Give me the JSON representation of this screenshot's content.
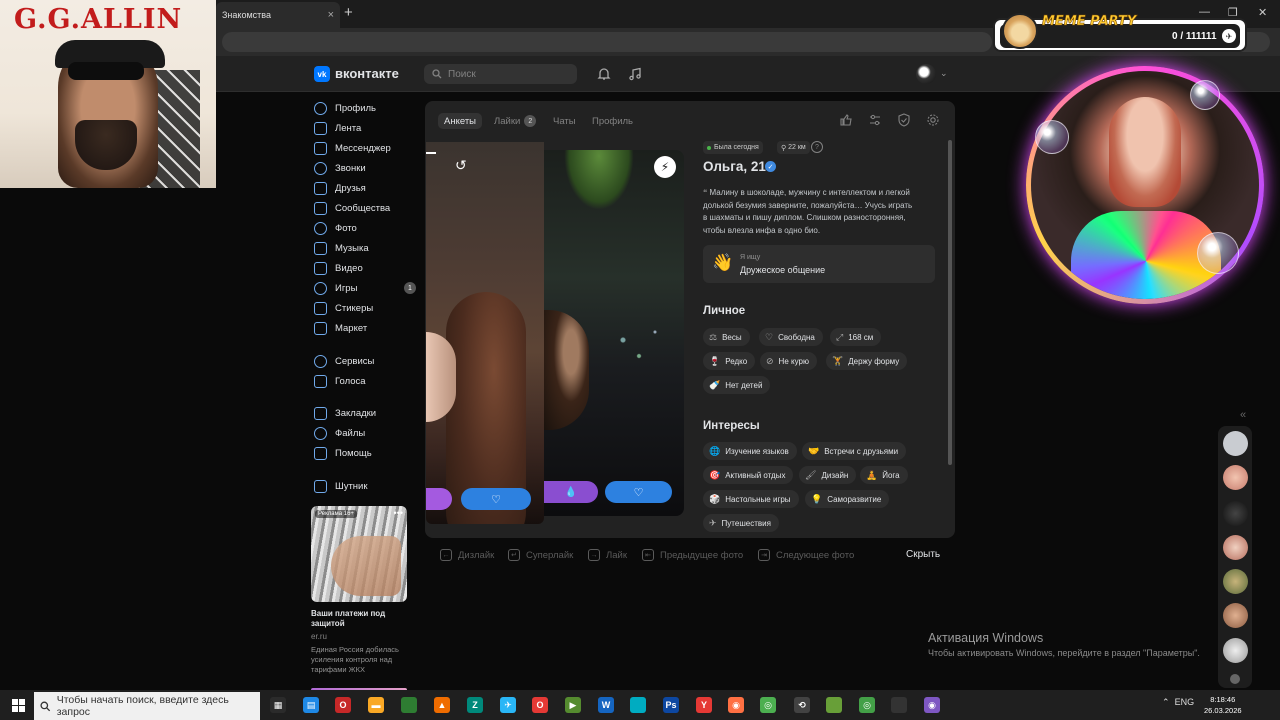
{
  "browser": {
    "tab_title": "Знакомства",
    "tab_close": "×",
    "new_tab": "+",
    "min": "—",
    "restore": "❐",
    "close": "✕"
  },
  "vk": {
    "logo_letter": "vk",
    "name": "вконтакте",
    "search_placeholder": "Поиск",
    "accent": "#0077ff"
  },
  "nav": {
    "items": [
      {
        "label": "Профиль",
        "icon": "user-circle-icon"
      },
      {
        "label": "Лента",
        "icon": "feed-icon"
      },
      {
        "label": "Мессенджер",
        "icon": "chat-icon"
      },
      {
        "label": "Звонки",
        "icon": "phone-icon"
      },
      {
        "label": "Друзья",
        "icon": "friends-icon"
      },
      {
        "label": "Сообщества",
        "icon": "groups-icon"
      },
      {
        "label": "Фото",
        "icon": "photo-icon"
      },
      {
        "label": "Музыка",
        "icon": "music-icon"
      },
      {
        "label": "Видео",
        "icon": "video-icon"
      },
      {
        "label": "Игры",
        "icon": "games-icon",
        "badge": "1"
      },
      {
        "label": "Стикеры",
        "icon": "stickers-icon"
      },
      {
        "label": "Маркет",
        "icon": "market-icon"
      },
      {
        "label": "Сервисы",
        "icon": "services-icon"
      },
      {
        "label": "Голоса",
        "icon": "votes-icon"
      },
      {
        "label": "Закладки",
        "icon": "bookmark-icon"
      },
      {
        "label": "Файлы",
        "icon": "files-icon"
      },
      {
        "label": "Помощь",
        "icon": "help-icon"
      },
      {
        "label": "Шутник",
        "icon": "community-icon"
      }
    ]
  },
  "ad": {
    "label": "Реклама 16+",
    "dots": "•••",
    "title": "Ваши платежи под защитой",
    "url": "er.ru",
    "description": "Единая Россия добилась усиления контроля над тарифами ЖКХ"
  },
  "dating": {
    "tabs": [
      {
        "label": "Анкеты",
        "active": true
      },
      {
        "label": "Лайки",
        "count": "2"
      },
      {
        "label": "Чаты"
      },
      {
        "label": "Профиль"
      }
    ],
    "status": "Была сегодня",
    "distance": "22 км",
    "help": "?",
    "name": "Ольга, 21",
    "bio": "Малину в шоколаде, мужчину с интеллектом и легкой долькой безумия заверните, пожалуйста… Учусь играть в шахматы и пишу диплом. Слишком разносторонняя, чтобы влезла инфа в одно био.",
    "seeking_label": "Я ищу",
    "seeking_value": "Дружеское общение",
    "personal_title": "Личное",
    "personal": [
      {
        "icon": "⚖",
        "label": "Весы"
      },
      {
        "icon": "♡",
        "label": "Свободна"
      },
      {
        "icon": "⤢",
        "label": "168 см"
      },
      {
        "icon": "🍷",
        "label": "Редко"
      },
      {
        "icon": "⊘",
        "label": "Не курю"
      },
      {
        "icon": "🏋",
        "label": "Держу форму"
      },
      {
        "icon": "🍼",
        "label": "Нет детей"
      }
    ],
    "interests_title": "Интересы",
    "interests": [
      {
        "icon": "🌐",
        "label": "Изучение языков"
      },
      {
        "icon": "🤝",
        "label": "Встречи с друзьями"
      },
      {
        "icon": "🎯",
        "label": "Активный отдых"
      },
      {
        "icon": "🖌",
        "label": "Дизайн"
      },
      {
        "icon": "🧘",
        "label": "Йога"
      },
      {
        "icon": "🎲",
        "label": "Настольные игры"
      },
      {
        "icon": "💡",
        "label": "Саморазвитие"
      },
      {
        "icon": "✈",
        "label": "Путешествия"
      }
    ],
    "hints": [
      {
        "key": "←",
        "label": "Дизлайк"
      },
      {
        "key": "↵",
        "label": "Суперлайк"
      },
      {
        "key": "→",
        "label": "Лайк"
      },
      {
        "key": "⇤",
        "label": "Предыдущее фото"
      },
      {
        "key": "⇥",
        "label": "Следующее фото"
      }
    ],
    "hide": "Скрыть",
    "undo_icon": "↺",
    "bolt_icon": "⚡",
    "heart": "♡",
    "superlike": "💧"
  },
  "overlay": {
    "gg_title": "G.G.ALLIN",
    "meme_title": "MEME PARTY",
    "meme_count": "0 / 111111",
    "meme_icon": "✈"
  },
  "windows": {
    "activation_title": "Активация Windows",
    "activation_text": "Чтобы активировать Windows, перейдите в раздел \"Параметры\".",
    "search_placeholder": "Чтобы начать поиск, введите здесь запрос",
    "lang": "ENG",
    "time": "8:18:46",
    "date": "26.03.2026",
    "collapse": "«"
  }
}
